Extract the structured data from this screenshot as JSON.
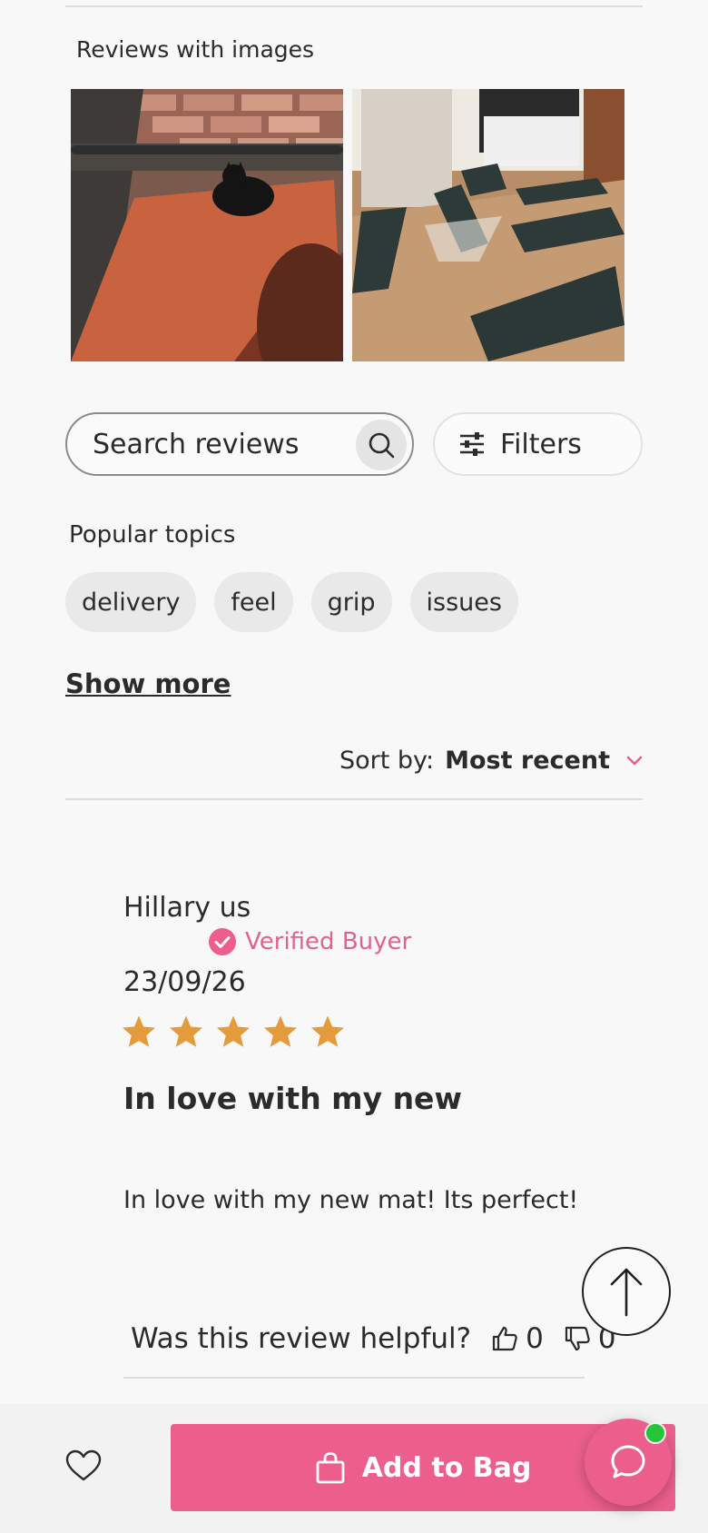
{
  "reviews_with_images": {
    "title": "Reviews with images",
    "images": [
      {
        "alt": "black cat on orange yoga mat"
      },
      {
        "alt": "dark yoga mats on wooden floor"
      }
    ]
  },
  "search": {
    "placeholder": "Search reviews",
    "icon": "search-icon"
  },
  "filters": {
    "label": "Filters",
    "icon": "sliders-icon"
  },
  "topics": {
    "title": "Popular topics",
    "items": [
      "delivery",
      "feel",
      "grip",
      "issues"
    ],
    "show_more": "Show more"
  },
  "sort": {
    "label": "Sort by:",
    "value": "Most recent"
  },
  "review": {
    "author": "Hillary us",
    "verified": "Verified Buyer",
    "date": "23/09/26",
    "rating": 5,
    "rating_max": 5,
    "title": "In love with my new",
    "body": "In love with my new mat! Its perfect!",
    "helpful_question": "Was this review helpful?",
    "upvotes": "0",
    "downvotes": "0"
  },
  "bottom_bar": {
    "add_to_bag": "Add to Bag"
  },
  "colors": {
    "accent": "#ec5f8c",
    "star": "#e39b3b",
    "online": "#25c43a"
  }
}
